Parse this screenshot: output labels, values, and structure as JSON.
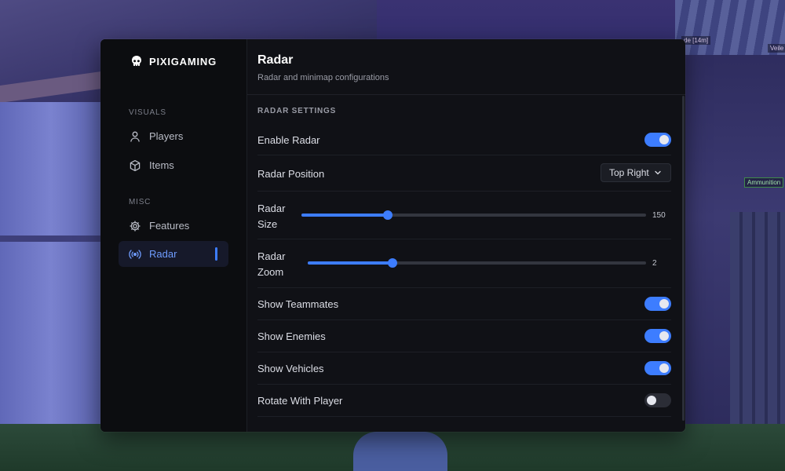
{
  "app": {
    "brand": "PIXIGAMING"
  },
  "background": {
    "tags": [
      "de [14m]",
      "Veile",
      "Ammunition"
    ]
  },
  "sidebar": {
    "sections": [
      {
        "label": "VISUALS",
        "items": [
          {
            "label": "Players",
            "icon": "user-icon"
          },
          {
            "label": "Items",
            "icon": "box-icon"
          }
        ]
      },
      {
        "label": "MISC",
        "items": [
          {
            "label": "Features",
            "icon": "gear-icon"
          },
          {
            "label": "Radar",
            "icon": "radar-icon",
            "active": true
          }
        ]
      }
    ]
  },
  "page": {
    "title": "Radar",
    "subtitle": "Radar and minimap configurations",
    "section_label": "RADAR SETTINGS"
  },
  "settings": {
    "enable_radar": {
      "label": "Enable Radar",
      "on": true
    },
    "radar_position": {
      "label": "Radar Position",
      "value": "Top Right"
    },
    "radar_size": {
      "label_line1": "Radar",
      "label_line2": "Size",
      "value": "150",
      "fill": 0.25
    },
    "radar_zoom": {
      "label_line1": "Radar",
      "label_line2": "Zoom",
      "value": "2",
      "fill": 0.25
    },
    "show_teammates": {
      "label": "Show Teammates",
      "on": true
    },
    "show_enemies": {
      "label": "Show Enemies",
      "on": true
    },
    "show_vehicles": {
      "label": "Show Vehicles",
      "on": true
    },
    "rotate_with_player": {
      "label": "Rotate With Player",
      "on": false
    }
  },
  "colors": {
    "accent": "#3d7dff",
    "panel": "#101116",
    "sidebar": "#0c0d10"
  }
}
